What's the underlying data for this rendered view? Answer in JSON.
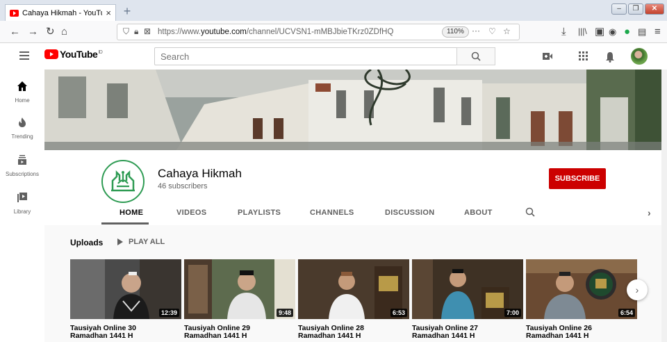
{
  "browser": {
    "tab_title": "Cahaya Hikmah - YouTube",
    "tab_close": "×",
    "new_tab": "+",
    "url_prefix": "https://www.",
    "url_domain": "youtube.com",
    "url_path": "/channel/UCVSN1-mMBJbieTKrz0ZDfHQ",
    "zoom": "110%",
    "more": "···"
  },
  "youtube": {
    "logo_text": "YouTube",
    "logo_country": "ID",
    "search_placeholder": "Search"
  },
  "sidebar": {
    "items": [
      {
        "label": "Home",
        "icon": "home-icon"
      },
      {
        "label": "Trending",
        "icon": "fire-icon"
      },
      {
        "label": "Subscriptions",
        "icon": "subscriptions-icon"
      },
      {
        "label": "Library",
        "icon": "library-icon"
      }
    ]
  },
  "channel": {
    "name": "Cahaya Hikmah",
    "subscribers": "46 subscribers",
    "subscribe_label": "SUBSCRIBE",
    "tabs": [
      "HOME",
      "VIDEOS",
      "PLAYLISTS",
      "CHANNELS",
      "DISCUSSION",
      "ABOUT"
    ],
    "active_tab": "HOME"
  },
  "uploads": {
    "heading": "Uploads",
    "play_all": "PLAY ALL",
    "videos": [
      {
        "title1": "Tausiyah Online 30",
        "title2": "Ramadhan 1441 H",
        "duration": "12:39"
      },
      {
        "title1": "Tausiyah Online 29",
        "title2": "Ramadhan 1441 H",
        "duration": "9:48"
      },
      {
        "title1": "Tausiyah Online 28",
        "title2": "Ramadhan 1441 H",
        "duration": "6:53"
      },
      {
        "title1": "Tausiyah Online 27",
        "title2": "Ramadhan 1441 H",
        "duration": "7:00"
      },
      {
        "title1": "Tausiyah Online 26",
        "title2": "Ramadhan 1441 H",
        "duration": "6:54"
      }
    ]
  },
  "colors": {
    "subscribe": "#cc0000",
    "youtube_red": "#ff0000",
    "logo_green": "#2e9b53"
  }
}
